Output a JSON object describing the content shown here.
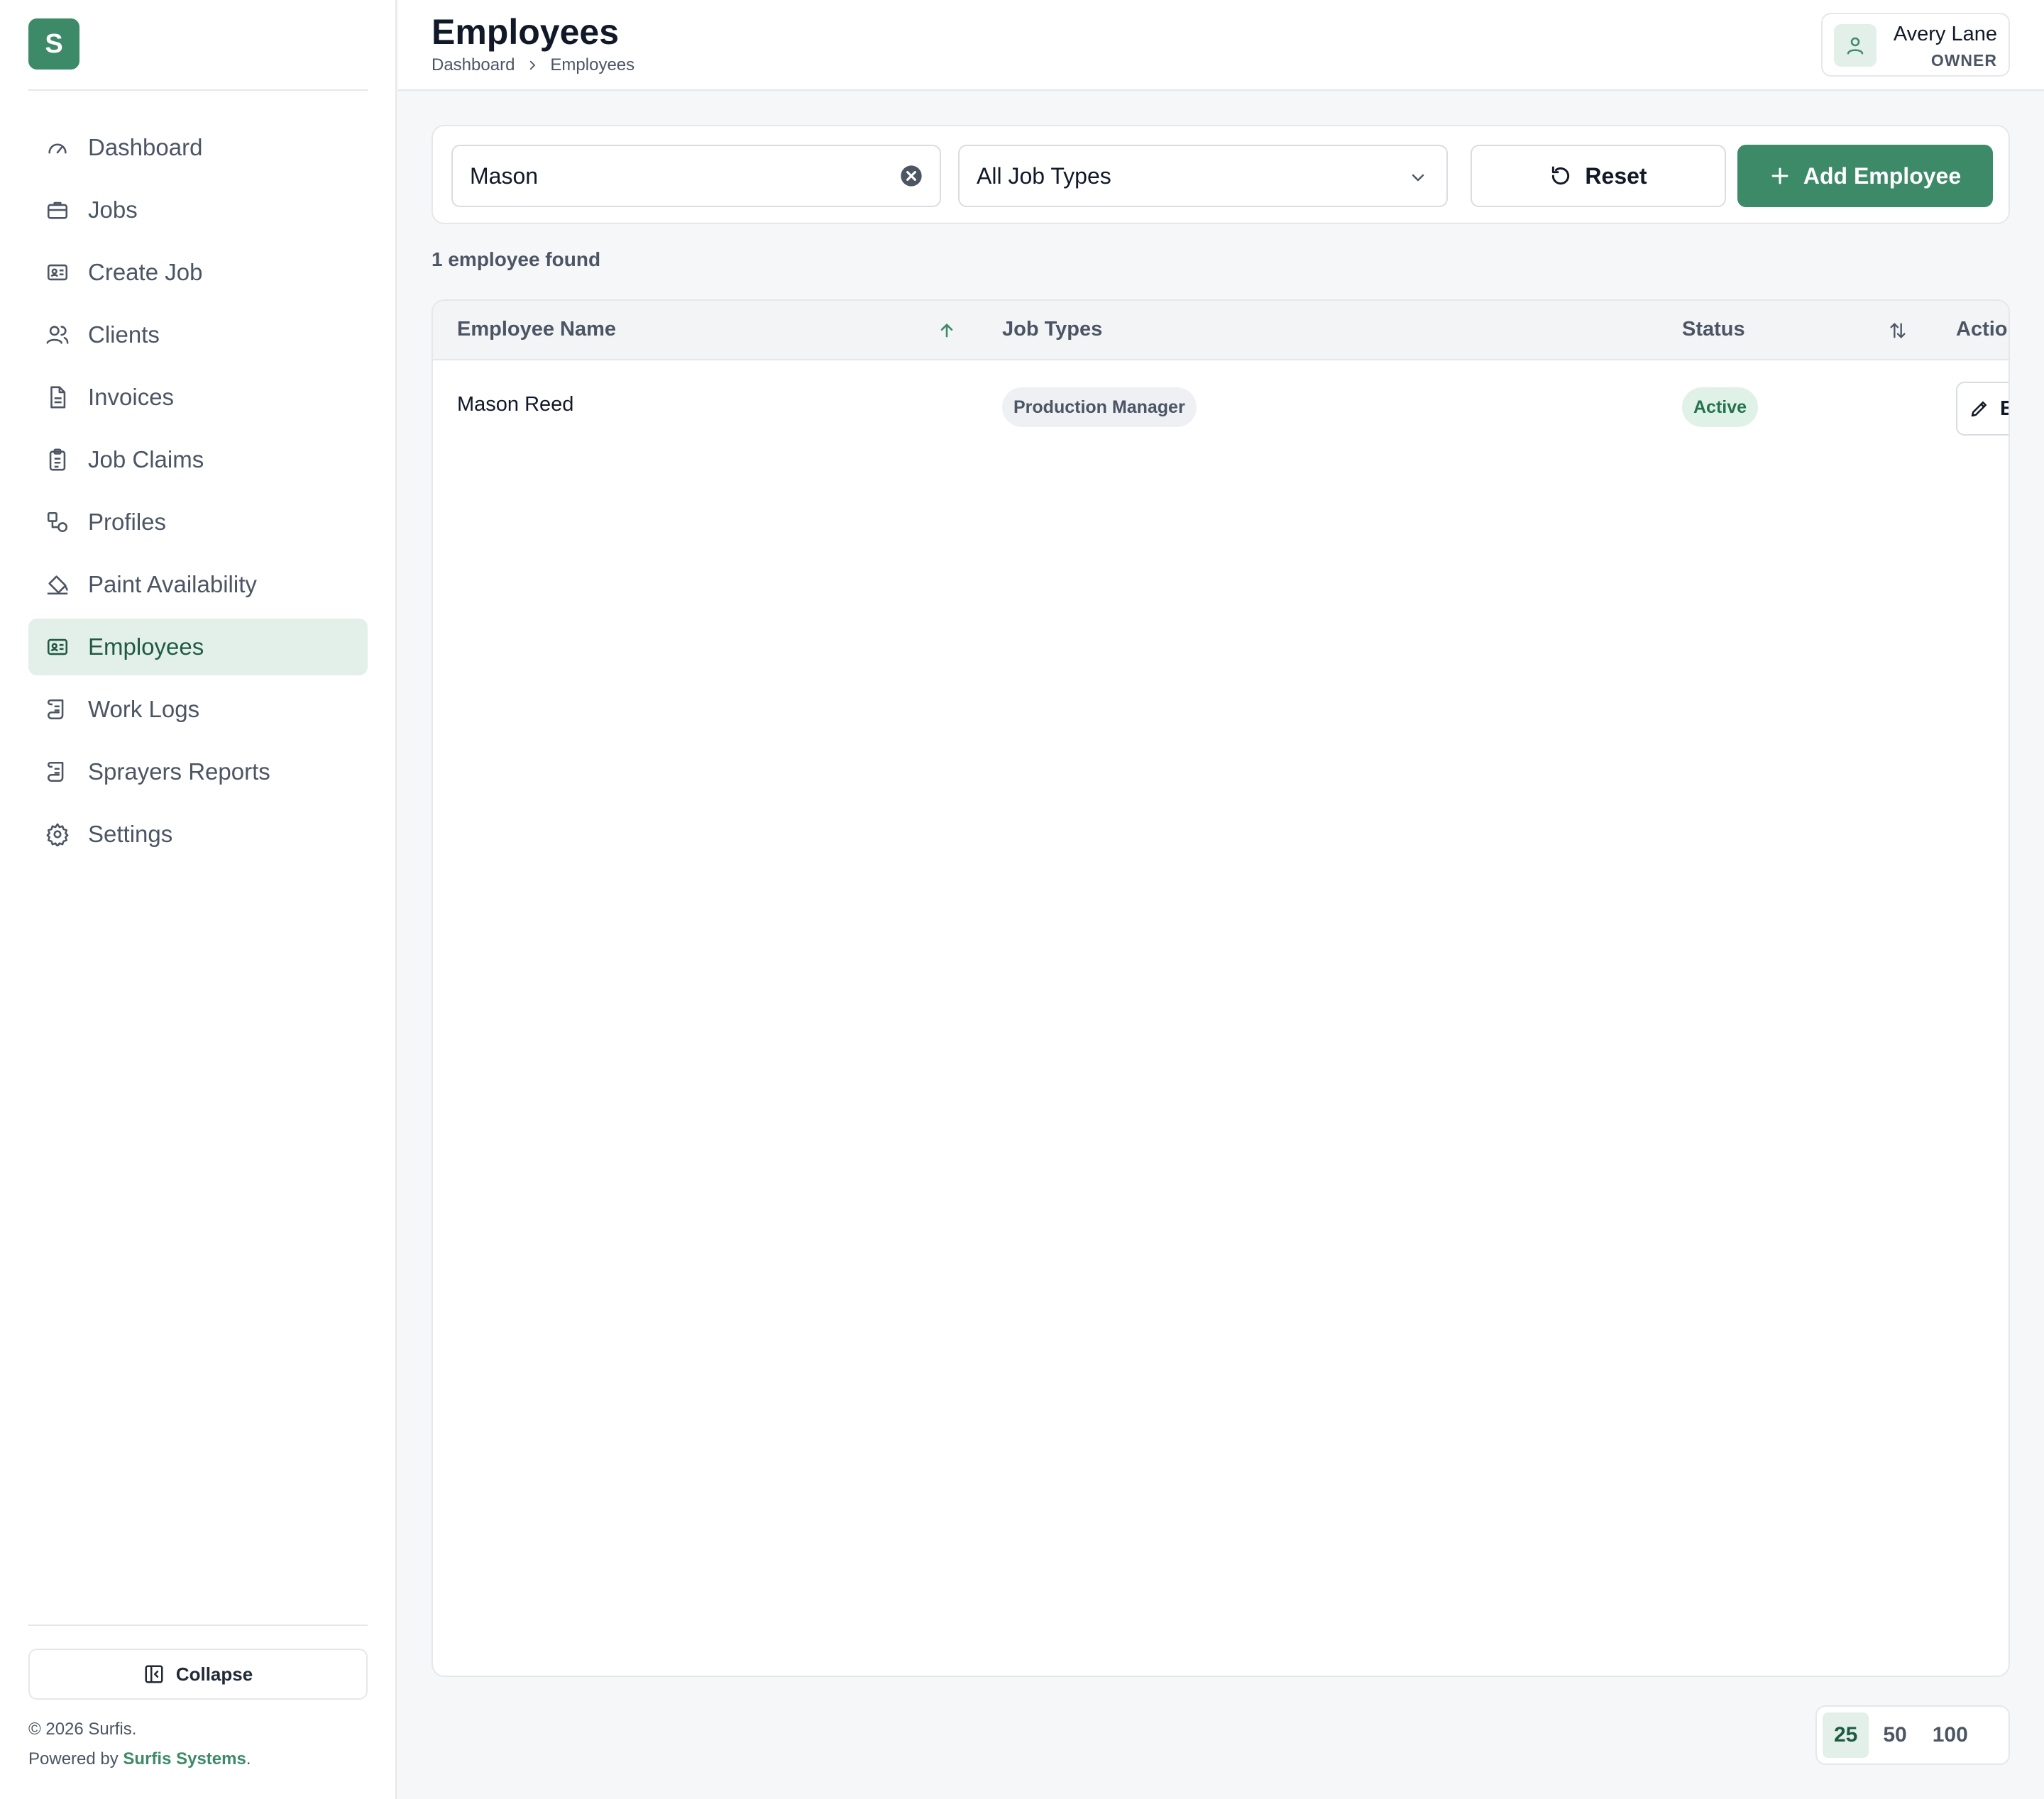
{
  "brand": {
    "logo_letter": "S",
    "accent": "#3d8a68"
  },
  "sidebar": {
    "items": [
      {
        "label": "Dashboard",
        "icon": "gauge-icon",
        "active": false
      },
      {
        "label": "Jobs",
        "icon": "briefcase-icon",
        "active": false
      },
      {
        "label": "Create Job",
        "icon": "id-card-icon",
        "active": false
      },
      {
        "label": "Clients",
        "icon": "users-icon",
        "active": false
      },
      {
        "label": "Invoices",
        "icon": "document-icon",
        "active": false
      },
      {
        "label": "Job Claims",
        "icon": "clipboard-icon",
        "active": false
      },
      {
        "label": "Profiles",
        "icon": "shapes-icon",
        "active": false
      },
      {
        "label": "Paint Availability",
        "icon": "paint-bucket-icon",
        "active": false
      },
      {
        "label": "Employees",
        "icon": "id-card-icon",
        "active": true
      },
      {
        "label": "Work Logs",
        "icon": "scroll-icon",
        "active": false
      },
      {
        "label": "Sprayers Reports",
        "icon": "scroll-icon",
        "active": false
      },
      {
        "label": "Settings",
        "icon": "gear-icon",
        "active": false
      }
    ],
    "collapse_label": "Collapse",
    "copyright": "© 2026 Surfis.",
    "powered_prefix": "Powered by ",
    "powered_brand": "Surfis Systems",
    "powered_suffix": "."
  },
  "header": {
    "title": "Employees",
    "breadcrumb": [
      "Dashboard",
      "Employees"
    ],
    "user": {
      "name": "Avery Lane",
      "role": "OWNER"
    }
  },
  "filters": {
    "search_value": "Mason",
    "job_type_selected": "All Job Types",
    "reset_label": "Reset",
    "add_label": "Add Employee"
  },
  "results": {
    "count_text": "1 employee found"
  },
  "table": {
    "columns": [
      "Employee Name",
      "Job Types",
      "Status",
      "Actions"
    ],
    "rows": [
      {
        "name": "Mason Reed",
        "job_type": "Production Manager",
        "status": "Active",
        "action_label": "Edit"
      }
    ]
  },
  "pagination": {
    "options": [
      "25",
      "50",
      "100"
    ],
    "selected": "25"
  }
}
